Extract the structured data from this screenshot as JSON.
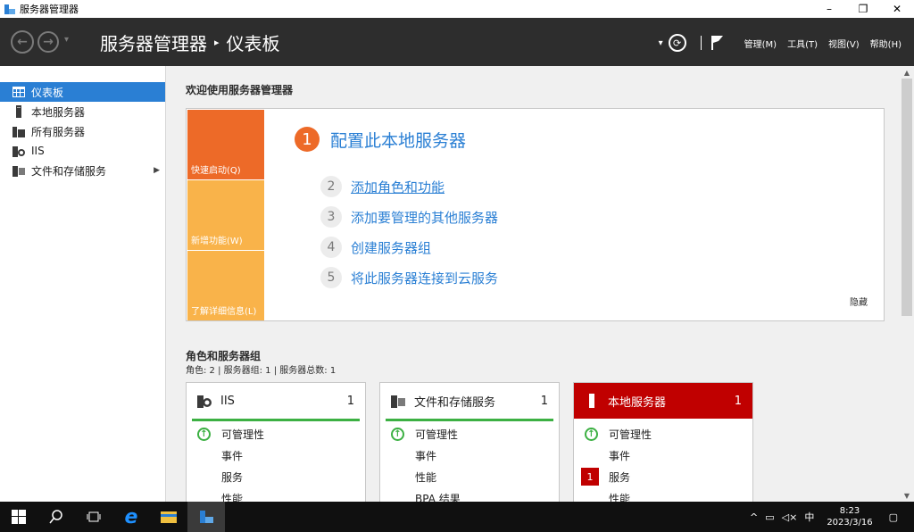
{
  "window": {
    "title": "服务器管理器",
    "minimize": "–",
    "maximize": "❐",
    "close": "✕"
  },
  "header": {
    "back": "←",
    "forward": "→",
    "dropdown": "▾",
    "app_name": "服务器管理器",
    "separator": "▸",
    "page": "仪表板",
    "menus": [
      "管理(M)",
      "工具(T)",
      "视图(V)",
      "帮助(H)"
    ]
  },
  "sidebar": {
    "items": [
      {
        "label": "仪表板",
        "icon": "dashboard-icon",
        "active": true
      },
      {
        "label": "本地服务器",
        "icon": "server-icon"
      },
      {
        "label": "所有服务器",
        "icon": "servers-icon"
      },
      {
        "label": "IIS",
        "icon": "iis-icon"
      },
      {
        "label": "文件和存储服务",
        "icon": "file-storage-icon",
        "has_arrow": true
      }
    ]
  },
  "welcome": {
    "title": "欢迎使用服务器管理器",
    "tiles": [
      "快速启动(Q)",
      "新增功能(W)",
      "了解详细信息(L)"
    ],
    "step1": {
      "num": "1",
      "label": "配置此本地服务器"
    },
    "steps": [
      {
        "num": "2",
        "label": "添加角色和功能"
      },
      {
        "num": "3",
        "label": "添加要管理的其他服务器"
      },
      {
        "num": "4",
        "label": "创建服务器组"
      },
      {
        "num": "5",
        "label": "将此服务器连接到云服务"
      }
    ],
    "hide": "隐藏"
  },
  "roles": {
    "title": "角色和服务器组",
    "subtitle": "角色: 2 | 服务器组: 1 | 服务器总数: 1",
    "cards": [
      {
        "name": "IIS",
        "count": "1",
        "rows": [
          "可管理性",
          "事件",
          "服务",
          "性能"
        ]
      },
      {
        "name": "文件和存储服务",
        "count": "1",
        "rows": [
          "可管理性",
          "事件",
          "性能",
          "BPA 结果"
        ]
      },
      {
        "name": "本地服务器",
        "count": "1",
        "rows": [
          "可管理性",
          "事件",
          "服务",
          "性能"
        ],
        "badge": "1"
      }
    ]
  },
  "taskbar": {
    "ime": "中",
    "time": "8:23",
    "date": "2023/3/16"
  },
  "colors": {
    "accent": "#2a7fd4",
    "orange": "#ed6a28",
    "light_orange": "#f9b34a",
    "alert_red": "#c00000",
    "ok_green": "#3cb043"
  }
}
